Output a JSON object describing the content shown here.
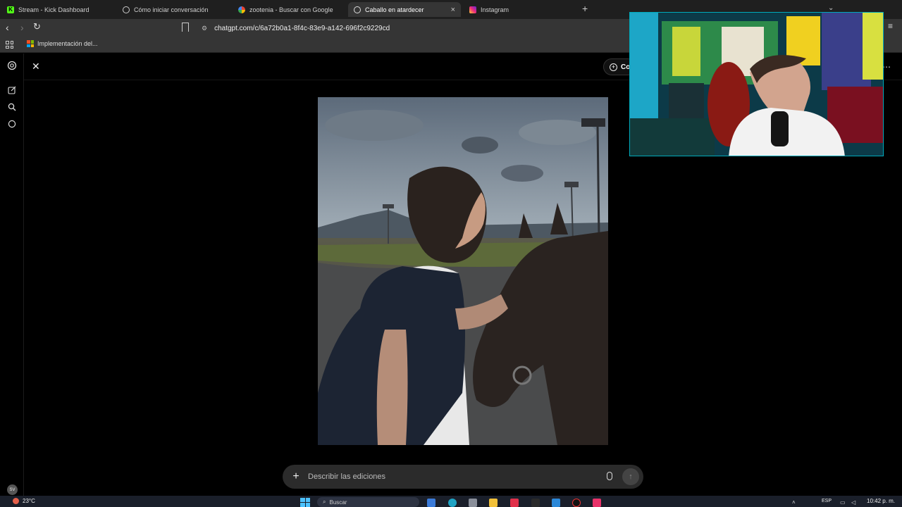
{
  "browser": {
    "tabs": [
      {
        "label": "Stream - Kick Dashboard",
        "icon": "kick-icon",
        "active": false
      },
      {
        "label": "Cómo iniciar conversación",
        "icon": "chatgpt-icon",
        "active": false
      },
      {
        "label": "zootenia - Buscar con Google",
        "icon": "google-icon",
        "active": false
      },
      {
        "label": "Caballo en atardecer",
        "icon": "chatgpt-icon",
        "active": true
      },
      {
        "label": "Instagram",
        "icon": "instagram-icon",
        "active": false
      }
    ],
    "tab_close_glyph": "×",
    "new_tab_glyph": "+",
    "address": "chatgpt.com/c/6a72b0a1-8f4c-83e9-a142-696f2c9229cd",
    "bookmark": "Implementación del..."
  },
  "app": {
    "create_button_label": "Co",
    "composer": {
      "placeholder": "Describir las ediciones",
      "plus_glyph": "+",
      "send_glyph": "↑"
    },
    "user_initials": "SV"
  },
  "taskbar": {
    "weather": "23°C",
    "search_placeholder": "Buscar",
    "language": "ESP",
    "time": "10:42 p. m."
  },
  "colors": {
    "accent_chatgpt_bg": "#000000",
    "tab_bar": "#1f1f1f",
    "toolbar": "#353535",
    "composer_bg": "#2b2b2b",
    "kick_green": "#53fc18",
    "windows_blue": "#4cc2ff"
  }
}
